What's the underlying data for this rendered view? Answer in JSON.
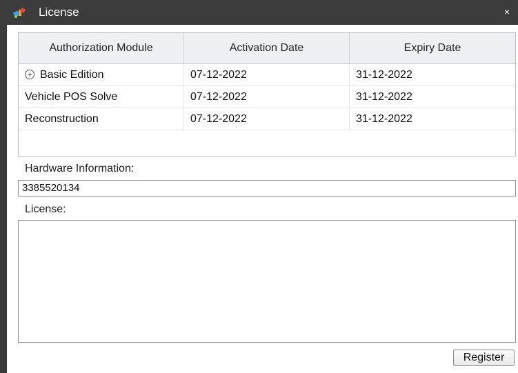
{
  "window": {
    "title": "License",
    "icon": "app-satellite-icon",
    "close_glyph": "×"
  },
  "table": {
    "headers": [
      "Authorization Module",
      "Activation Date",
      "Expiry Date"
    ],
    "rows": [
      {
        "module": "Basic Edition",
        "activation": "07-12-2022",
        "expiry": "31-12-2022",
        "expandable": true
      },
      {
        "module": "Vehicle POS Solve",
        "activation": "07-12-2022",
        "expiry": "31-12-2022",
        "expandable": false
      },
      {
        "module": "Reconstruction",
        "activation": "07-12-2022",
        "expiry": "31-12-2022",
        "expandable": false
      }
    ]
  },
  "hardware": {
    "label": "Hardware Information:",
    "value": "3385520134"
  },
  "license": {
    "label": "License:",
    "value": ""
  },
  "actions": {
    "register_label": "Register"
  },
  "colors": {
    "titlebar": "#3c3c3c",
    "header_bg": "#eef0f3",
    "border": "#8e8e8e"
  }
}
